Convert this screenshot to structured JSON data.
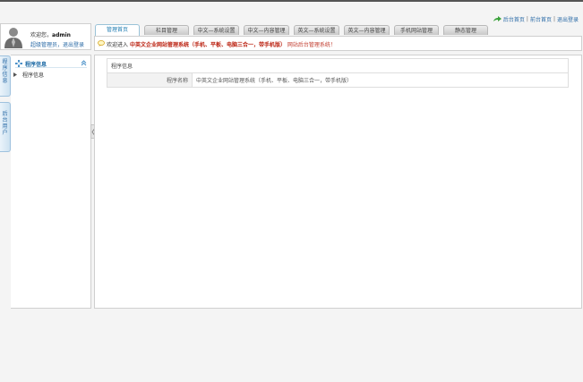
{
  "top_links": {
    "admin_home": "后台首页",
    "front_home": "前台首页",
    "logout": "退出登录",
    "sep": "|"
  },
  "user": {
    "welcome_prefix": "欢迎您，",
    "name": "admin",
    "role": "超级管理员",
    "comma": "，",
    "logout": "退出登录"
  },
  "tabs": [
    {
      "label": "管理首页",
      "active": true
    },
    {
      "label": "栏目管理"
    },
    {
      "label": "中文—系统设置"
    },
    {
      "label": "中文—内容管理"
    },
    {
      "label": "英文—系统设置"
    },
    {
      "label": "英文—内容管理"
    },
    {
      "label": "手机网站管理"
    },
    {
      "label": "静态管理"
    }
  ],
  "welcome_bar": {
    "prefix": "欢迎进入",
    "system_name": "中英文企业网站管理系统（手机、平板、电脑三合一，带手机版）",
    "suffix": "网站后台管理系统！"
  },
  "side_tabs": {
    "program_info": "程序信息",
    "admin_users": "后台用户"
  },
  "left_nav": {
    "heading": "程序信息",
    "items": [
      {
        "label": "程序信息"
      }
    ]
  },
  "main": {
    "caption": "程序信息",
    "rows": [
      {
        "label": "程序名称",
        "value": "中英文企业网站管理系统（手机、平板、电脑三合一，带手机版）"
      }
    ]
  },
  "colors": {
    "link": "#2a6aa6",
    "accent_red": "#c0392b",
    "tab_active_text": "#1d7bb0"
  },
  "icons": {
    "top": "green-arrow-icon",
    "avatar": "user-avatar-icon",
    "bubble": "speech-bubble-icon",
    "nav_plus": "plus-cross-icon",
    "nav_collapse": "double-chevron-up-icon",
    "nav_item": "triangle-right-icon",
    "handle": "chevron-left-icon"
  }
}
